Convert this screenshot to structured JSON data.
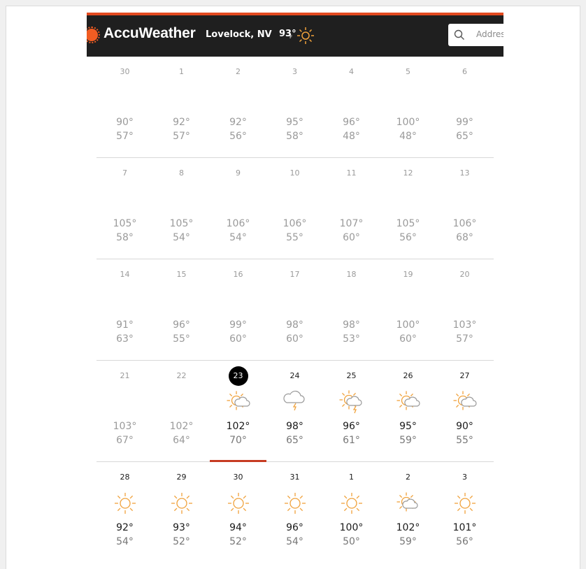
{
  "header": {
    "brand": "AccuWeather",
    "location": "Lovelock, NV",
    "current_temp": "93°",
    "current_unit": "F",
    "current_icon": "sun-icon",
    "search_placeholder": "Address"
  },
  "colors": {
    "brand_orange": "#f15c22",
    "header_bg": "#1f1f1f",
    "accent_top": "#e2491f",
    "today_underline": "#c63b22",
    "weather_icon": "#f0a23c",
    "cloud_icon": "#9a9a9a"
  },
  "calendar": {
    "weeks": [
      {
        "days": [
          {
            "date": "30",
            "hi": "90°",
            "lo": "57°"
          },
          {
            "date": "1",
            "hi": "92°",
            "lo": "57°"
          },
          {
            "date": "2",
            "hi": "92°",
            "lo": "56°"
          },
          {
            "date": "3",
            "hi": "95°",
            "lo": "58°"
          },
          {
            "date": "4",
            "hi": "96°",
            "lo": "48°"
          },
          {
            "date": "5",
            "hi": "100°",
            "lo": "48°"
          },
          {
            "date": "6",
            "hi": "99°",
            "lo": "65°"
          }
        ]
      },
      {
        "days": [
          {
            "date": "7",
            "hi": "105°",
            "lo": "58°"
          },
          {
            "date": "8",
            "hi": "105°",
            "lo": "54°"
          },
          {
            "date": "9",
            "hi": "106°",
            "lo": "54°"
          },
          {
            "date": "10",
            "hi": "106°",
            "lo": "55°"
          },
          {
            "date": "11",
            "hi": "107°",
            "lo": "60°"
          },
          {
            "date": "12",
            "hi": "105°",
            "lo": "56°"
          },
          {
            "date": "13",
            "hi": "106°",
            "lo": "68°"
          }
        ]
      },
      {
        "days": [
          {
            "date": "14",
            "hi": "91°",
            "lo": "63°"
          },
          {
            "date": "15",
            "hi": "96°",
            "lo": "55°"
          },
          {
            "date": "16",
            "hi": "99°",
            "lo": "60°"
          },
          {
            "date": "17",
            "hi": "98°",
            "lo": "60°"
          },
          {
            "date": "18",
            "hi": "98°",
            "lo": "53°"
          },
          {
            "date": "19",
            "hi": "100°",
            "lo": "60°"
          },
          {
            "date": "20",
            "hi": "103°",
            "lo": "57°"
          }
        ]
      },
      {
        "days": [
          {
            "date": "21",
            "hi": "103°",
            "lo": "67°"
          },
          {
            "date": "22",
            "hi": "102°",
            "lo": "64°"
          },
          {
            "date": "23",
            "hi": "102°",
            "lo": "70°",
            "icon": "sun-cloud-icon"
          },
          {
            "date": "24",
            "hi": "98°",
            "lo": "65°",
            "icon": "cloud-thunder-icon"
          },
          {
            "date": "25",
            "hi": "96°",
            "lo": "61°",
            "icon": "sun-cloud-thunder-icon"
          },
          {
            "date": "26",
            "hi": "95°",
            "lo": "59°",
            "icon": "sun-cloud-icon"
          },
          {
            "date": "27",
            "hi": "90°",
            "lo": "55°",
            "icon": "sun-cloud-icon"
          }
        ]
      },
      {
        "days": [
          {
            "date": "28",
            "hi": "92°",
            "lo": "54°",
            "icon": "sun-icon"
          },
          {
            "date": "29",
            "hi": "93°",
            "lo": "52°",
            "icon": "sun-icon"
          },
          {
            "date": "30",
            "hi": "94°",
            "lo": "52°",
            "icon": "sun-icon"
          },
          {
            "date": "31",
            "hi": "96°",
            "lo": "54°",
            "icon": "sun-icon"
          },
          {
            "date": "1",
            "hi": "100°",
            "lo": "50°",
            "icon": "sun-icon"
          },
          {
            "date": "2",
            "hi": "102°",
            "lo": "59°",
            "icon": "partly-cloudy-icon"
          },
          {
            "date": "3",
            "hi": "101°",
            "lo": "56°",
            "icon": "sun-icon"
          }
        ]
      }
    ]
  }
}
